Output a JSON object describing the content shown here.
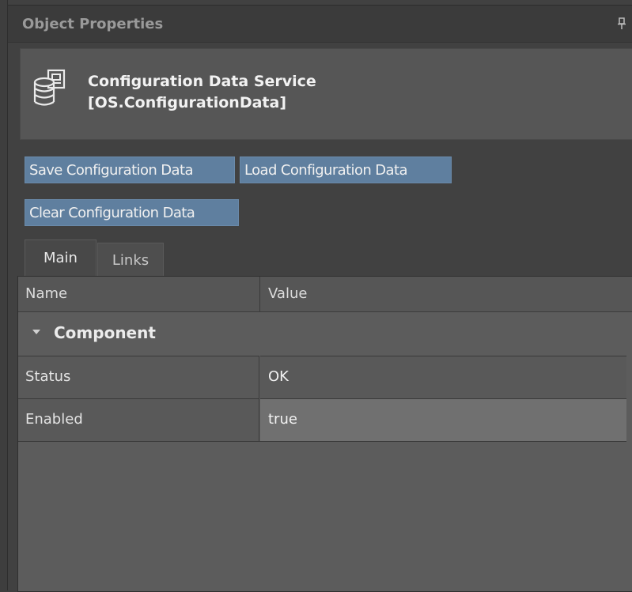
{
  "panel": {
    "title": "Object Properties",
    "pin_icon": "pin-icon"
  },
  "object": {
    "icon": "configuration-data-icon",
    "name_line1": "Configuration Data Service",
    "name_line2": "[OS.ConfigurationData]"
  },
  "actions": {
    "save": "Save Configuration Data",
    "load": "Load Configuration Data",
    "clear": "Clear Configuration Data"
  },
  "tabs": [
    {
      "label": "Main",
      "selected": true
    },
    {
      "label": "Links",
      "selected": false
    }
  ],
  "grid": {
    "columns": [
      "Name",
      "Value"
    ],
    "category": "Component",
    "rows": [
      {
        "name": "Status",
        "value": "OK"
      },
      {
        "name": "Enabled",
        "value": "true"
      }
    ]
  },
  "colors": {
    "button_bg": "#5f7f9f",
    "panel_bg": "#414141",
    "selected_value_bg": "#707070"
  }
}
